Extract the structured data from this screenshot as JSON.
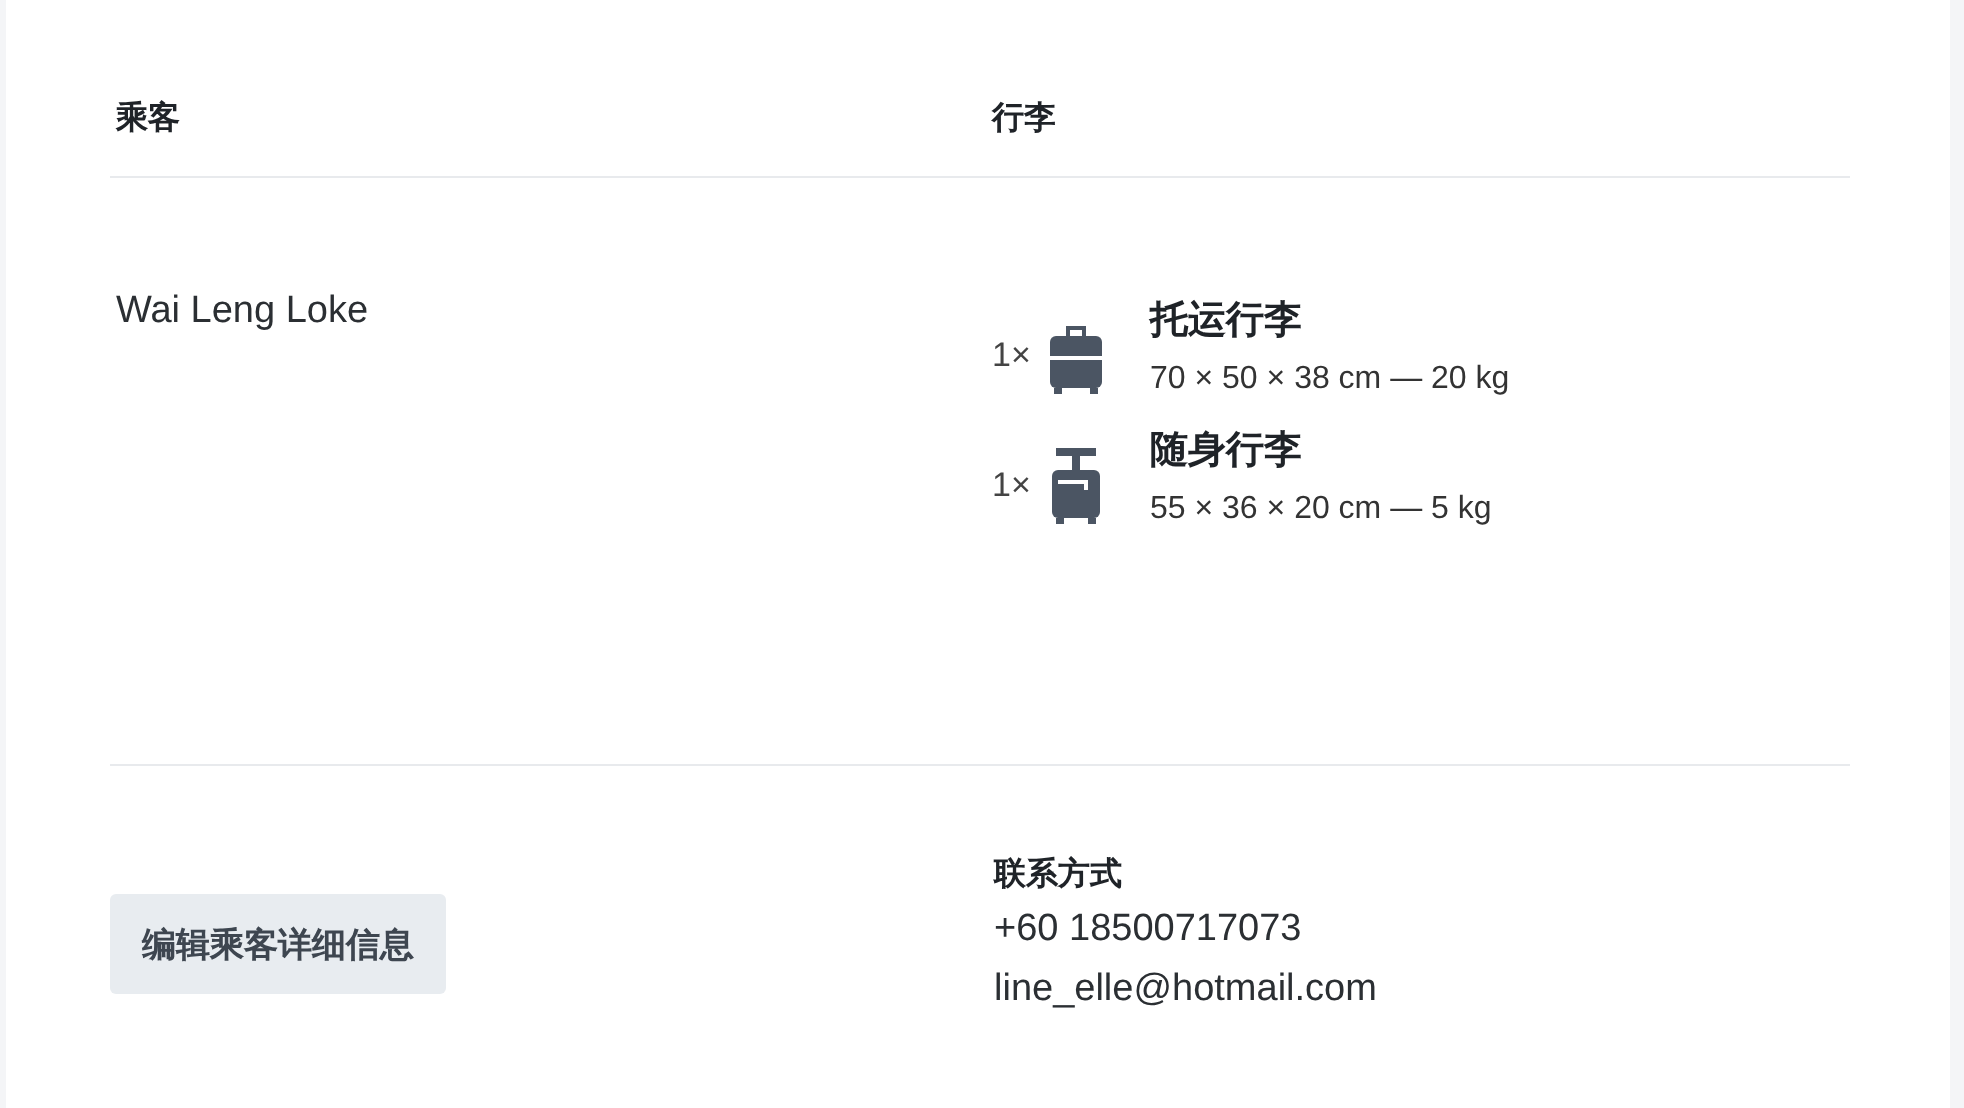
{
  "table": {
    "columns": [
      "乘客",
      "行李"
    ],
    "rows": [
      {
        "passenger": "Wai Leng Loke",
        "baggage": [
          {
            "kind": "checked",
            "quantity": "1×",
            "name": "托运行李",
            "size": "70 × 50 × 38 cm — 20 kg"
          },
          {
            "kind": "cabin",
            "quantity": "1×",
            "name": "随身行李",
            "size": "55 × 36 × 20 cm — 5 kg"
          }
        ]
      }
    ]
  },
  "edit_button": "编辑乘客详细信息",
  "contact": {
    "label": "联系方式",
    "phone": "+60 18500717073",
    "email": "line_elle@hotmail.com"
  }
}
